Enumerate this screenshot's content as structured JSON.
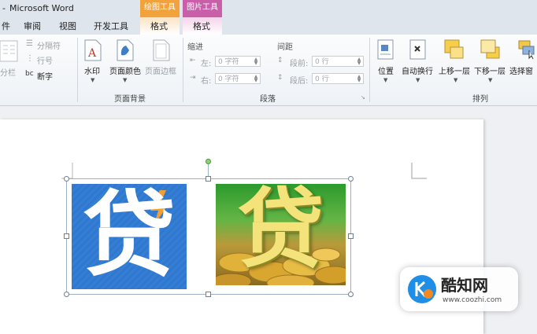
{
  "window": {
    "title": "Microsoft Word",
    "title_prefix": "-"
  },
  "context_tabs": [
    {
      "label": "绘图工具",
      "color": "#f2a23a"
    },
    {
      "label": "图片工具",
      "color": "#c95fa8"
    }
  ],
  "tabs": [
    {
      "label": "件"
    },
    {
      "label": "审阅"
    },
    {
      "label": "视图"
    },
    {
      "label": "开发工具"
    },
    {
      "label": "格式"
    },
    {
      "label": "格式"
    }
  ],
  "ribbon": {
    "setup": {
      "break_label": "分隔符",
      "line_numbers_label": "行号",
      "hyphenation_label": "断字",
      "columns_label": "分栏"
    },
    "page_background": {
      "group_label": "页面背景",
      "watermark_label": "水印",
      "page_color_label": "页面颜色",
      "page_borders_label": "页面边框"
    },
    "paragraph": {
      "group_label": "段落",
      "indent_header": "缩进",
      "spacing_header": "间距",
      "indent_left_label": "左:",
      "indent_right_label": "右:",
      "indent_left_value": "0 字符",
      "indent_right_value": "0 字符",
      "spacing_before_label": "段前:",
      "spacing_after_label": "段后:",
      "spacing_before_value": "0 行",
      "spacing_after_value": "0 行"
    },
    "arrange": {
      "group_label": "排列",
      "position_label": "位置",
      "wrap_label": "自动换行",
      "bring_forward_label": "上移一层",
      "send_backward_label": "下移一层",
      "selection_pane_label": "选择窗"
    }
  },
  "document": {
    "image1_char": "贷",
    "image2_char": "贷"
  },
  "watermark": {
    "site_name": "酷知网",
    "site_url": "www.coozhi.com"
  }
}
